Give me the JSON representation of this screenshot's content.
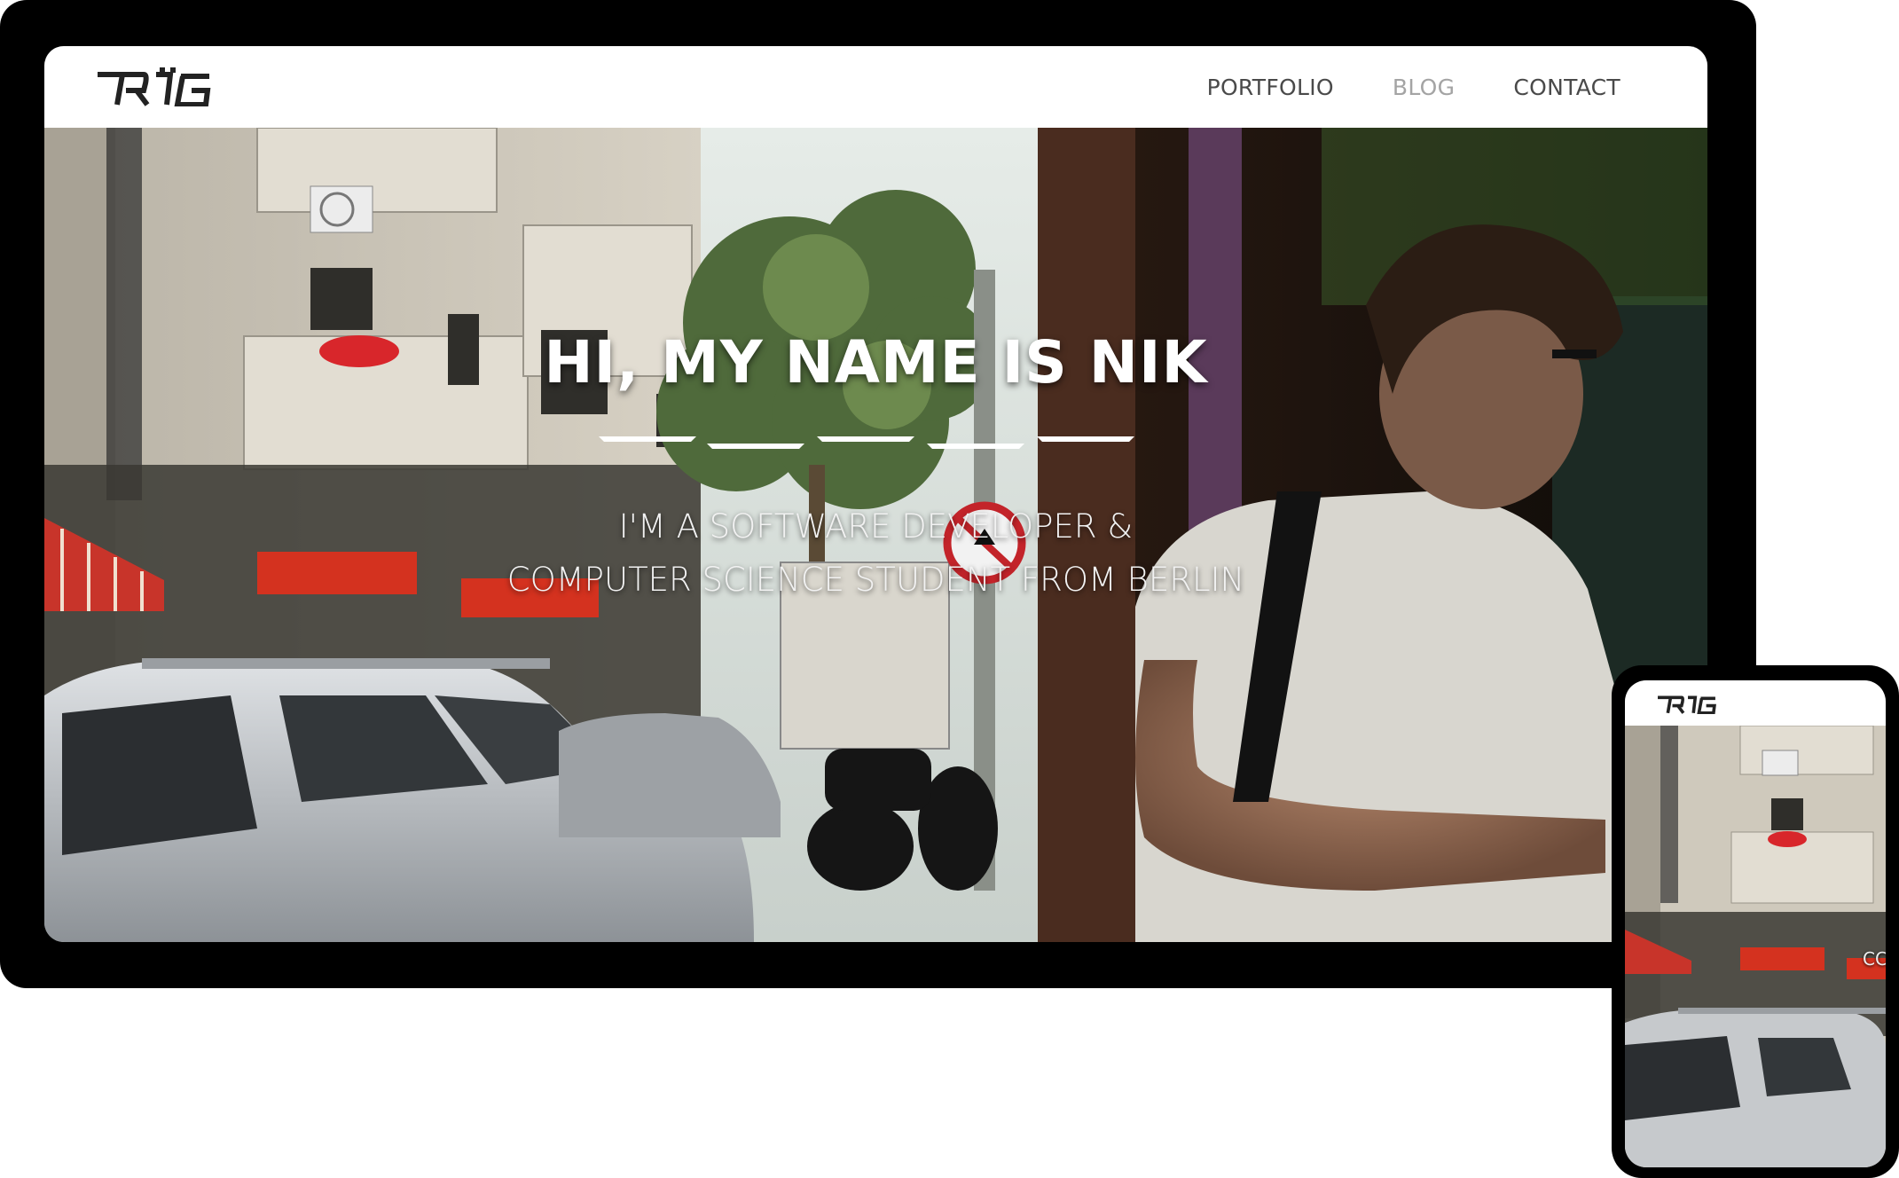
{
  "site": {
    "logo_alt": "TRIG logo",
    "nav": {
      "items": [
        {
          "label": "PORTFOLIO",
          "state": "default"
        },
        {
          "label": "BLOG",
          "state": "muted"
        },
        {
          "label": "CONTACT",
          "state": "default"
        }
      ]
    },
    "hero": {
      "title": "HI, MY NAME IS NIK",
      "subtitle_line1": "I'M A SOFTWARE DEVELOPER &",
      "subtitle_line2": "COMPUTER SCIENCE STUDENT FROM BERLIN"
    }
  },
  "phone": {
    "logo_alt": "TRIG logo",
    "subtitle_fragment": "CC"
  },
  "colors": {
    "device_frame": "#000000",
    "nav_bg": "#ffffff",
    "nav_text": "#4a4a4a",
    "nav_text_muted": "#a4a4a4",
    "hero_text": "#ffffff",
    "awning_red": "#c8342a",
    "shop_sign_red": "#d4321f"
  },
  "icons": {
    "logo": "trig-logo-icon",
    "no-turn-sign": "no-left-turn-sign-icon",
    "divider": "segmented-divider-icon"
  }
}
